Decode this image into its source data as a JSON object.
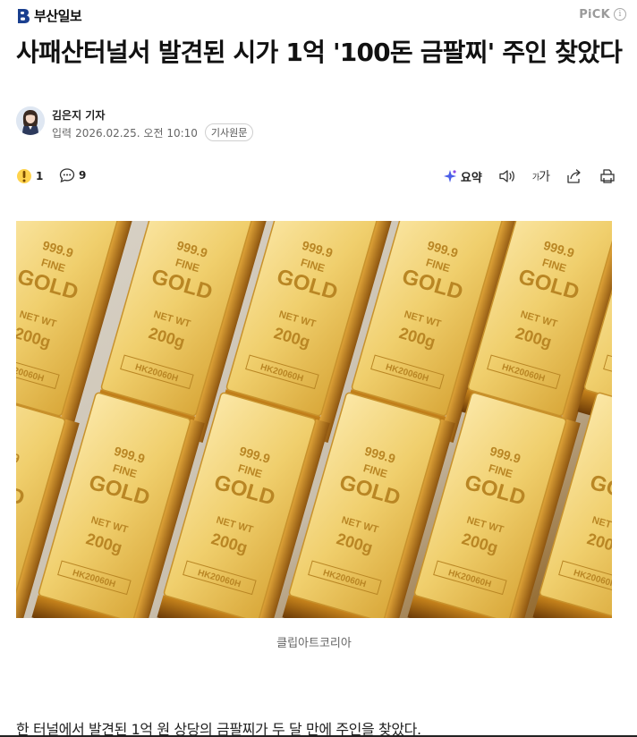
{
  "header": {
    "press_name": "부산일보",
    "pick_label": "PiCK",
    "pick_info": "i"
  },
  "article": {
    "title": "사패산터널서 발견된 시가 1억 '100돈 금팔찌' 주인 찾았다",
    "reporter": "김은지 기자",
    "date_label": "입력",
    "date_value": "2026.02.25. 오전 10:10",
    "original_link": "기사원문"
  },
  "actions": {
    "reaction_count": "1",
    "comment_count": "9",
    "summary_label": "요약",
    "font_big": "가",
    "font_small": "가"
  },
  "photo": {
    "bar_text_purity": "999.9",
    "bar_text_fine": "FINE",
    "bar_text_gold": "GOLD",
    "bar_text_netwt": "NET WT",
    "bar_text_weight": "200g",
    "bar_text_serial": "HK20060H"
  },
  "caption": "클립아트코리아",
  "lead": "한 터널에서 발견된 1억 원 상당의 금팔찌가 두 달 만에 주인을 찾았다.",
  "colors": {
    "brand": "#1a3f8f",
    "text": "#111111",
    "muted": "#666666",
    "gold_light": "#f2d27a",
    "gold_dark": "#b07a1c"
  }
}
